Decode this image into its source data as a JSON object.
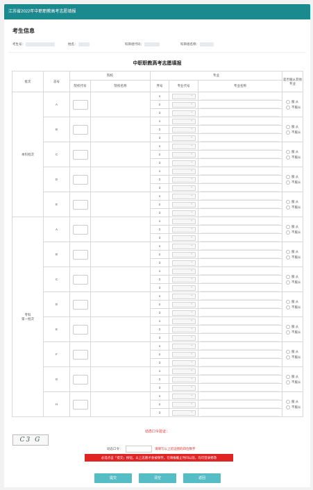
{
  "window": {
    "title": "江苏省2022年中职职教高考志愿填报"
  },
  "candidate": {
    "section_title": "考生信息",
    "exam_no_label": "考生号：",
    "name_label": "姓名：",
    "subject_code_label": "科目组代码：",
    "subject_name_label": "科目组名称："
  },
  "form": {
    "title": "中职职教高考志愿填报",
    "headers": {
      "batch": "批次",
      "order": "志号",
      "school_group": "院校",
      "major_group": "专业",
      "obey": "是否服从其他专业",
      "school_code": "院校代号",
      "school_name": "院校名称",
      "seq": "序号",
      "major_code": "专业代号",
      "major_name": "专业名称"
    },
    "batches": [
      {
        "name": "本科批次",
        "orders": [
          "A",
          "B",
          "C",
          "D",
          "E"
        ]
      },
      {
        "name": "专科\n第一批次",
        "orders": [
          "A",
          "B",
          "C",
          "D",
          "E",
          "F",
          "G",
          "H"
        ]
      }
    ],
    "seq_numbers": [
      "1",
      "2",
      "3"
    ],
    "obey_yes": "服 从",
    "obey_no": "不服从"
  },
  "verify": {
    "dynamic_label": "动态口令验证：",
    "captcha_text": "C3 G",
    "password_label": "动态口令：",
    "password_hint": "请填写以上验证图的四位数字"
  },
  "warning": "必选点击「提交」按钮，以上志愿才会被保存，在填报截止时间以前，均可登录修改",
  "buttons": {
    "submit": "提交",
    "clear": "清空",
    "back": "返回"
  },
  "colors": {
    "titlebar": "#1a8a8f",
    "button": "#57bdc5",
    "warning": "#e02424"
  }
}
